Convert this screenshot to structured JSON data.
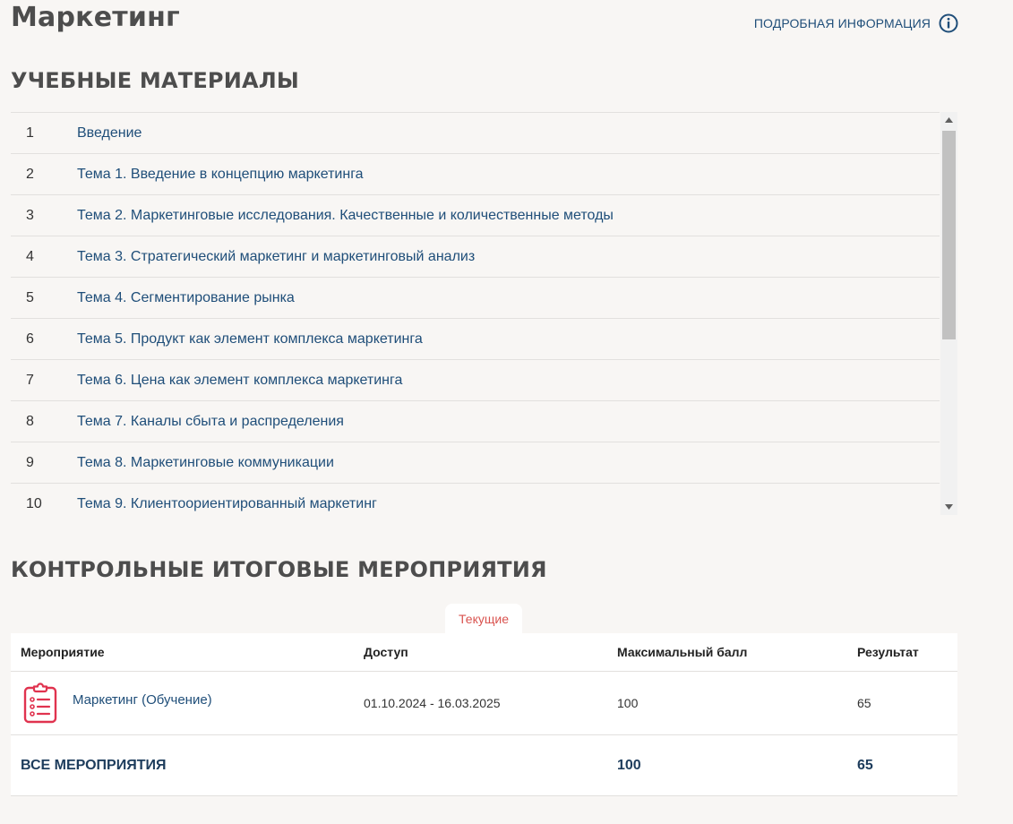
{
  "header": {
    "title": "Маркетинг",
    "info_link_label": "ПОДРОБНАЯ ИНФОРМАЦИЯ",
    "info_icon": "info-circle-icon"
  },
  "materials": {
    "title": "УЧЕБНЫЕ МАТЕРИАЛЫ",
    "items": [
      {
        "num": "1",
        "label": "Введение"
      },
      {
        "num": "2",
        "label": "Тема 1. Введение в концепцию маркетинга"
      },
      {
        "num": "3",
        "label": "Тема 2. Маркетинговые исследования. Качественные и количественные методы"
      },
      {
        "num": "4",
        "label": "Тема 3. Стратегический маркетинг и маркетинговый анализ"
      },
      {
        "num": "5",
        "label": "Тема 4. Сегментирование рынка"
      },
      {
        "num": "6",
        "label": "Тема 5. Продукт как элемент комплекса маркетинга"
      },
      {
        "num": "7",
        "label": "Тема 6. Цена как элемент комплекса маркетинга"
      },
      {
        "num": "8",
        "label": "Тема 7. Каналы сбыта и распределения"
      },
      {
        "num": "9",
        "label": "Тема 8. Маркетинговые коммуникации"
      },
      {
        "num": "10",
        "label": "Тема 9. Клиентоориентированный маркетинг"
      }
    ],
    "scroll_up_icon": "triangle-up-icon",
    "scroll_down_icon": "triangle-down-icon"
  },
  "events": {
    "title": "КОНТРОЛЬНЫЕ ИТОГОВЫЕ МЕРОПРИЯТИЯ",
    "tab_label": "Текущие",
    "columns": [
      "Мероприятие",
      "Доступ",
      "Максимальный балл",
      "Результат"
    ],
    "rows": [
      {
        "icon": "clipboard-checklist-icon",
        "name": "Маркетинг (Обучение)",
        "access": "01.10.2024 - 16.03.2025",
        "max_score": "100",
        "result": "65"
      }
    ],
    "total": {
      "label": "ВСЕ МЕРОПРИЯТИЯ",
      "max_score": "100",
      "result": "65"
    }
  },
  "colors": {
    "background": "#f8f6f4",
    "link": "#1f4e79",
    "heading": "#4d4d4d",
    "tab_accent": "#d9534f",
    "icon_red": "#e0334f"
  }
}
